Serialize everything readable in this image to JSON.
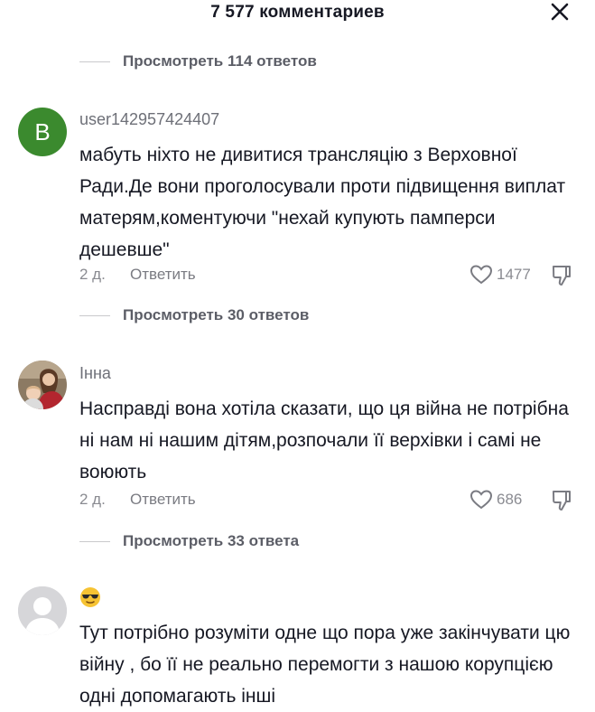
{
  "header": {
    "title": "7 577 комментариев",
    "close_icon": "close-icon"
  },
  "reply_links": [
    {
      "label": "Просмотреть 114 ответов"
    },
    {
      "label": "Просмотреть 30 ответов"
    },
    {
      "label": "Просмотреть 33 ответа"
    }
  ],
  "comments": [
    {
      "avatar_letter": "B",
      "avatar_color": "#3b8a2e",
      "username": "user142957424407",
      "text": "мабуть ніхто не дивитися трансляцію з Верховної Ради.Де вони проголосували проти підвищення виплат матерям,коментуючи \"нехай купують памперси дешевше\"",
      "date": "2 д.",
      "reply_label": "Ответить",
      "likes": "1477"
    },
    {
      "avatar_type": "photo",
      "username": "Інна",
      "text": "Насправді вона хотіла сказати, що ця війна не потрібна ні нам ні нашим дітям,розпочали її верхівки і самі не воюють",
      "date": "2 д.",
      "reply_label": "Ответить",
      "likes": "686"
    },
    {
      "avatar_type": "default",
      "username_icon": "sunglasses-emoji-icon",
      "text": "Тут потрібно розуміти одне що пора уже закінчувати цю війну , бо її не реально перемогти з нашою корупцією одні допомагають інші"
    }
  ]
}
